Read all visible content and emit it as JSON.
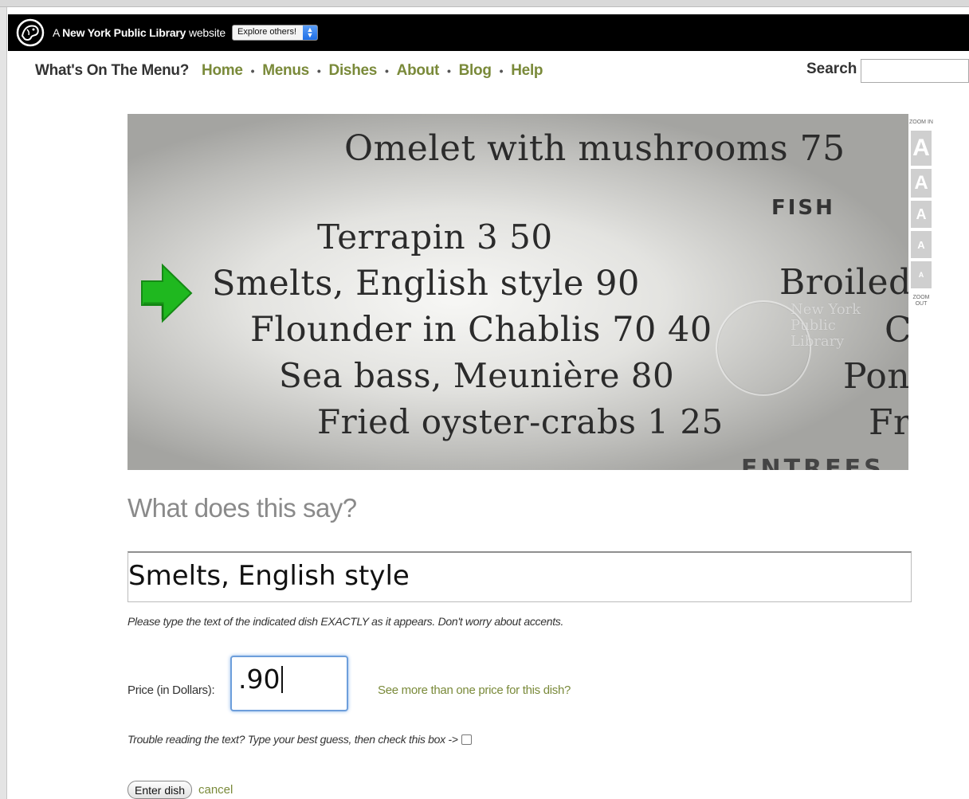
{
  "nypl_bar": {
    "prefix": "A",
    "brand": "New York Public Library",
    "suffix": "website",
    "explore_select": "Explore others!"
  },
  "nav": {
    "site_title": "What's On The Menu?",
    "items": [
      {
        "label": "Home"
      },
      {
        "label": "Menus"
      },
      {
        "label": "Dishes"
      },
      {
        "label": "About"
      },
      {
        "label": "Blog"
      },
      {
        "label": "Help"
      }
    ],
    "separator": "•",
    "search_label": "Search",
    "search_value": ""
  },
  "menu_image": {
    "lines": [
      "Omelet with mushrooms 75",
      "Terrapin 3 50",
      "Smelts, English style 90",
      "Flounder in Chablis 70 40",
      "Sea bass, Meunière 80",
      "Fried oyster-crabs 1 25"
    ],
    "fish_heading": "FISH",
    "right_column": [
      "Broiled",
      "C",
      "Pon",
      "Fr"
    ],
    "entrees_heading": "ENTREES",
    "watermark": [
      "New York",
      "Public",
      "Library"
    ]
  },
  "zoom": {
    "in_label": "ZOOM IN",
    "out_label": "ZOOM OUT",
    "levels": [
      "A",
      "A",
      "A",
      "A",
      "A"
    ]
  },
  "form": {
    "question": "What does this say?",
    "dish_value": "Smelts, English style",
    "hint": "Please type the text of the indicated dish EXACTLY as it appears. Don't worry about accents.",
    "price_label": "Price (in Dollars):",
    "price_value": ".90",
    "more_price_link": "See more than one price for this dish?",
    "trouble_text": "Trouble reading the text? Type your best guess, then check this box ->",
    "trouble_checked": false,
    "enter_button": "Enter dish",
    "cancel_link": "cancel"
  },
  "colors": {
    "nav_link": "#7a8a3a",
    "arrow": "#1fb81f",
    "focus": "#6d9edb"
  }
}
